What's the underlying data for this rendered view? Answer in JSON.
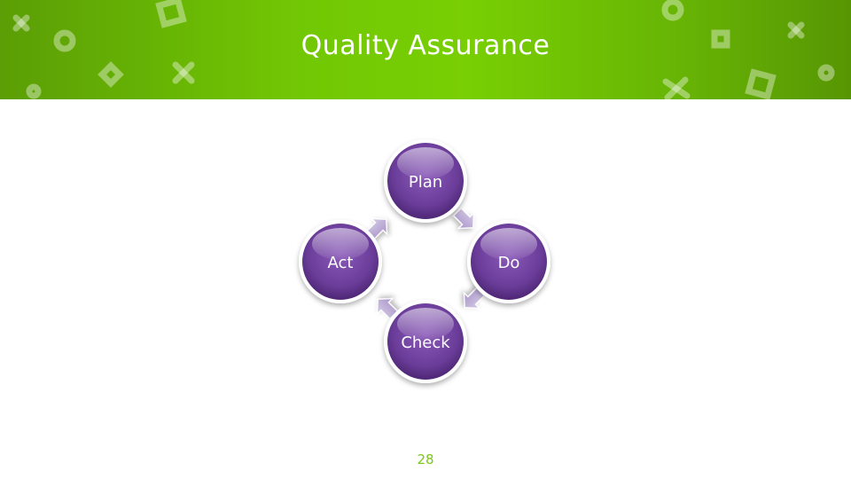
{
  "slide": {
    "title": "Quality Assurance",
    "page_number": "28"
  },
  "cycle": {
    "nodes": [
      {
        "label": "Plan"
      },
      {
        "label": "Do"
      },
      {
        "label": "Check"
      },
      {
        "label": "Act"
      }
    ]
  },
  "colors": {
    "header_green": "#72c704",
    "node_purple": "#6a3d9a",
    "arrow_lavender": "#b9a8d3",
    "page_number_green": "#7dc61a"
  }
}
